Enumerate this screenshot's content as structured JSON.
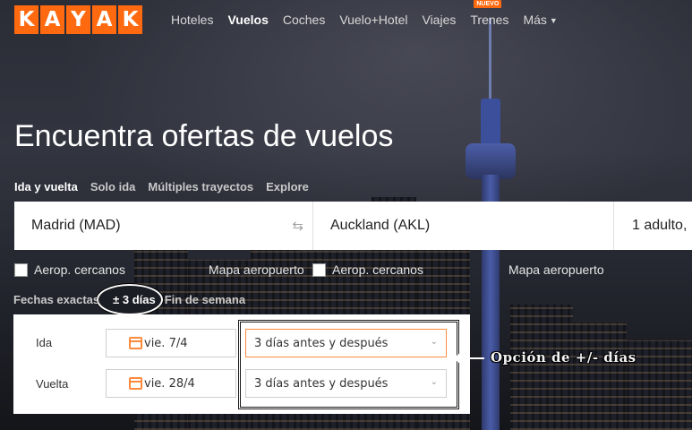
{
  "brand": {
    "logo_letters": [
      "K",
      "A",
      "Y",
      "A",
      "K"
    ],
    "accent": "#ff690f"
  },
  "nav": {
    "items": [
      {
        "label": "Hoteles"
      },
      {
        "label": "Vuelos",
        "active": true
      },
      {
        "label": "Coches"
      },
      {
        "label": "Vuelo+Hotel"
      },
      {
        "label": "Viajes"
      },
      {
        "label": "Trenes",
        "badge": "NUEVO"
      },
      {
        "label": "Más",
        "icon": "chevron-down-icon"
      }
    ]
  },
  "hero": {
    "title": "Encuentra ofertas de vuelos"
  },
  "trip_types": [
    "Ida y vuelta",
    "Solo ida",
    "Múltiples trayectos",
    "Explore"
  ],
  "search": {
    "origin": "Madrid (MAD)",
    "destination": "Auckland (AKL)",
    "passengers": "1 adulto,",
    "swap_icon": "swap-arrows-icon"
  },
  "options": {
    "nearby_origin": "Aerop. cercanos",
    "map_origin": "Mapa aeropuerto",
    "nearby_dest": "Aerop. cercanos",
    "map_dest": "Mapa aeropuerto"
  },
  "date_modes": {
    "exact": "Fechas exactas",
    "flex": "± 3 días",
    "weekend": "Fin de semana"
  },
  "dates": {
    "depart_label": "Ida",
    "depart_value": "vie. 7/4",
    "depart_flex": "3 días antes y después",
    "return_label": "Vuelta",
    "return_value": "vie. 28/4",
    "return_flex": "3 días antes y después",
    "calendar_icon": "calendar-icon"
  },
  "annotation": {
    "text": "Opción de +/- días"
  }
}
